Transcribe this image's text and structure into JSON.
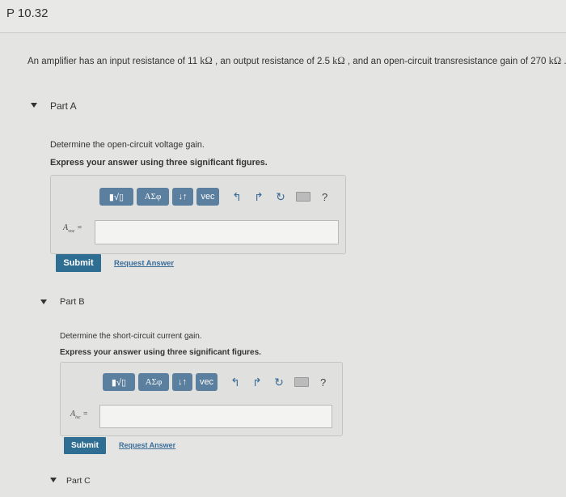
{
  "problem": {
    "title": "P 10.32",
    "text_part1": "An amplifier has an input resistance of 11 ",
    "unit1": "kΩ",
    "text_part2": " , an output resistance of 2.5 ",
    "unit2": "kΩ",
    "text_part3": " , and an open-circuit transresistance gain of 270 ",
    "unit3": "kΩ",
    "text_part4": " ."
  },
  "toolbar": {
    "matrix": "▮√▯",
    "greek": "ΑΣφ",
    "arrows": "↓↑",
    "vec": "vec",
    "undo": "↰",
    "redo": "↱",
    "reset": "↻",
    "help": "?"
  },
  "parts": {
    "a": {
      "label": "Part A",
      "question": "Determine the open-circuit voltage gain.",
      "instruction": "Express your answer using three significant figures.",
      "var_main": "A",
      "var_sub": "voc",
      "var_eq": "=",
      "submit": "Submit",
      "request": "Request Answer"
    },
    "b": {
      "label": "Part B",
      "question": "Determine the short-circuit current gain.",
      "instruction": "Express your answer using three significant figures.",
      "var_main": "A",
      "var_sub": "isc",
      "var_eq": "=",
      "submit": "Submit",
      "request": "Request Answer"
    },
    "c": {
      "label": "Part C"
    }
  }
}
